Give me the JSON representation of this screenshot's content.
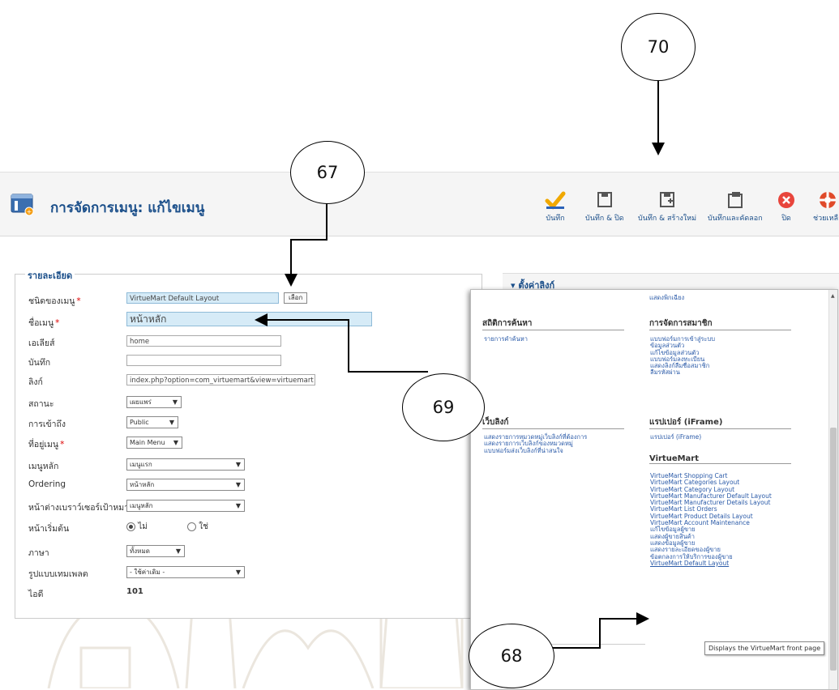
{
  "header": {
    "title": "การจัดการเมนู: แก้ไขเมนู",
    "toolbar": [
      {
        "id": "save",
        "label": "บันทึก",
        "icon": "check-icon",
        "color": "#f0a800"
      },
      {
        "id": "save_close",
        "label": "บันทึก & ปิด",
        "icon": "floppy-icon",
        "color": "#555555"
      },
      {
        "id": "save_new",
        "label": "บันทึก & สร้างใหม่",
        "icon": "floppy-plus-icon",
        "color": "#555555"
      },
      {
        "id": "save_copy",
        "label": "บันทึกและคัดลอก",
        "icon": "copy-icon",
        "color": "#555555"
      },
      {
        "id": "close",
        "label": "ปิด",
        "icon": "close-icon",
        "color": "#e8453c"
      },
      {
        "id": "help",
        "label": "ช่วยเหลือ",
        "icon": "lifebuoy-icon",
        "color": "#e04a2a"
      }
    ]
  },
  "details": {
    "legend": "รายละเอียด",
    "fields": {
      "menu_type": {
        "label": "ชนิดของเมนู",
        "value": "VirtueMart Default Layout",
        "button": "เลือก"
      },
      "menu_title": {
        "label": "ชื่อเมนู",
        "value": "หน้าหลัก"
      },
      "alias": {
        "label": "เอเลียส์",
        "value": "home"
      },
      "note": {
        "label": "บันทึก",
        "value": ""
      },
      "link": {
        "label": "ลิงก์",
        "value": "index.php?option=com_virtuemart&view=virtuemart"
      },
      "status": {
        "label": "สถานะ",
        "value": "เผยแพร่"
      },
      "access": {
        "label": "การเข้าถึง",
        "value": "Public"
      },
      "menu_location": {
        "label": "ที่อยู่เมนู",
        "value": "Main Menu"
      },
      "parent": {
        "label": "เมนูหลัก",
        "value": "เมนูแรก"
      },
      "ordering": {
        "label": "Ordering",
        "value": "หน้าหลัก"
      },
      "target_window": {
        "label": "หน้าต่างเบราว์เซอร์เป้าหมาย",
        "value": "เมนูหลัก"
      },
      "default_page": {
        "label": "หน้าเริ่มต้น",
        "options": [
          "ไม่",
          "ใช่"
        ],
        "selected": "ไม่"
      },
      "language": {
        "label": "ภาษา",
        "value": "ทั้งหมด"
      },
      "template_style": {
        "label": "รูปแบบเทมเพลต",
        "value": "- ใช้ค่าเดิม -"
      },
      "id": {
        "label": "ไอดี",
        "value": "101"
      }
    }
  },
  "right_panel": {
    "title": "ตั้งค่าลิงก์",
    "popup": {
      "top_link": "แสดงพิกเฉียง",
      "groups": [
        {
          "title": "สถิติการค้นหา",
          "links": [
            "รายการคำค้นหา"
          ]
        },
        {
          "title": "การจัดการสมาชิก",
          "links": [
            "แบบฟอร์มการเข้าสู่ระบบ",
            "ข้อมูลส่วนตัว",
            "แก้ไขข้อมูลส่วนตัว",
            "แบบฟอร์มลงทะเบียน",
            "แสดงลิงก์ลืมชื่อสมาชิก",
            "ลืมรหัสผ่าน"
          ]
        },
        {
          "title": "เว็บลิงก์",
          "links": [
            "แสดงรายการหมวดหมู่เว็บลิงก์ที่ต้องการ",
            "แสดงรายการเว็บลิงก์ของหมวดหมู่",
            "แบบฟอร์มส่งเว็บลิงก์ที่น่าสนใจ"
          ]
        },
        {
          "title": "แรปเปอร์ (iFrame)",
          "links": [
            "แรปเปอร์ (iFrame)"
          ]
        },
        {
          "title": "VirtueMart",
          "links": [
            "VirtueMart Shopping Cart",
            "VirtueMart Categories Layout",
            "VirtueMart Category Layout",
            "VirtueMart Manufacturer Default Layout",
            "VirtueMart Manufacturer Details Layout",
            "VirtueMart List Orders",
            "VirtueMart Product Details Layout",
            "VirtueMart Account Maintenance",
            "แก้ไขข้อมูลผู้ขาย",
            "แสดงผู้ขายสินค้า",
            "แสดงข้อมูลผู้ขาย",
            "แสดงรายละเอียดของผู้ขาย",
            "ข้อตกลงการให้บริการของผู้ขาย",
            "VirtueMart Default Layout"
          ]
        }
      ],
      "tooltip": "Displays the VirtueMart front page"
    }
  },
  "callouts": [
    "70",
    "67",
    "69",
    "68"
  ]
}
